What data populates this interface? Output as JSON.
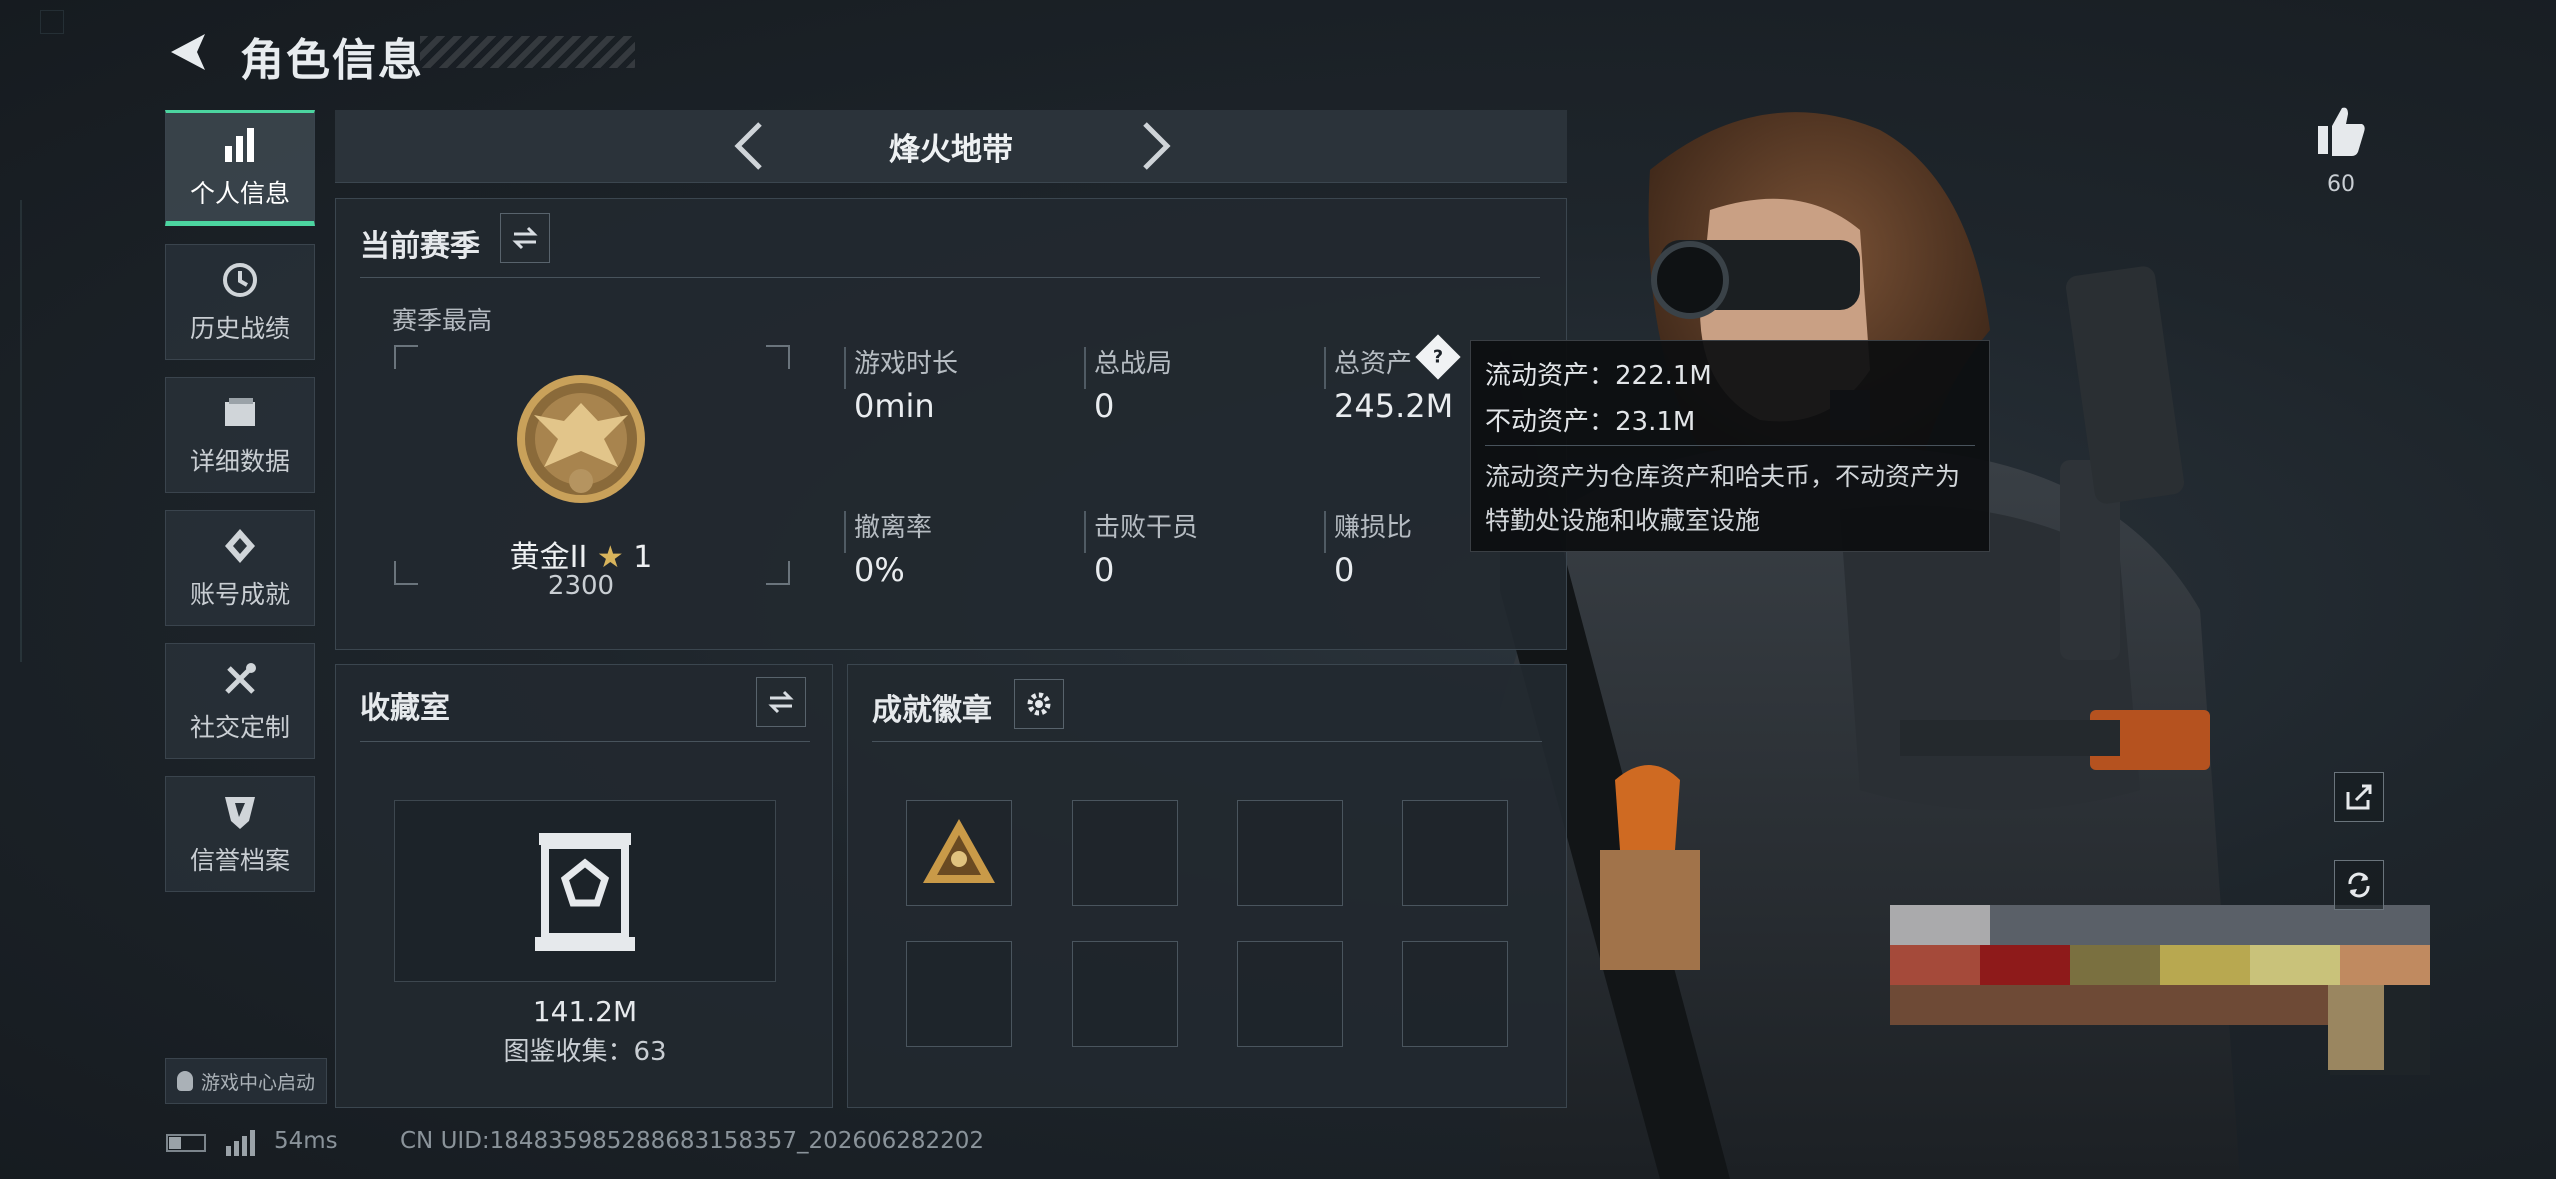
{
  "header": {
    "title": "角色信息"
  },
  "nav": [
    {
      "label": "个人信息",
      "icon": "bar-chart-icon",
      "active": true
    },
    {
      "label": "历史战绩",
      "icon": "history-clock-icon"
    },
    {
      "label": "详细数据",
      "icon": "folder-icon"
    },
    {
      "label": "账号成就",
      "icon": "achievement-emblem-icon"
    },
    {
      "label": "社交定制",
      "icon": "tools-icon"
    },
    {
      "label": "信誉档案",
      "icon": "shield-badge-icon"
    }
  ],
  "game_center": {
    "label": "游戏中心启动"
  },
  "status_bar": {
    "ping": "54ms",
    "uid": "CN UID:1848359852886831583​57_202606282202"
  },
  "mode": {
    "name": "烽火地带"
  },
  "season": {
    "title": "当前赛季",
    "best_label": "赛季最高",
    "rank_name": "黄金II",
    "rank_stars": "1",
    "rank_score": "2300",
    "stats": [
      {
        "label": "游戏时长",
        "value": "0min"
      },
      {
        "label": "总战局",
        "value": "0"
      },
      {
        "label": "总资产",
        "value": "245.2M"
      },
      {
        "label": "撤离率",
        "value": "0%"
      },
      {
        "label": "击败干员",
        "value": "0"
      },
      {
        "label": "赚损比",
        "value": "0"
      }
    ]
  },
  "tooltip": {
    "liquid": "流动资产：222.1M",
    "fixed": "不动资产：23.1M",
    "desc": "流动资产为仓库资产和哈夫币，不动资产为特勤处设施和收藏室设施"
  },
  "collection": {
    "title": "收藏室",
    "value": "141.2M",
    "count": "图鉴收集：63"
  },
  "badges": {
    "title": "成就徽章"
  },
  "likes": {
    "count": "60"
  },
  "colors": {
    "accent": "#4cd5a0",
    "panel": "#222930",
    "gold": "#c9a15a"
  }
}
